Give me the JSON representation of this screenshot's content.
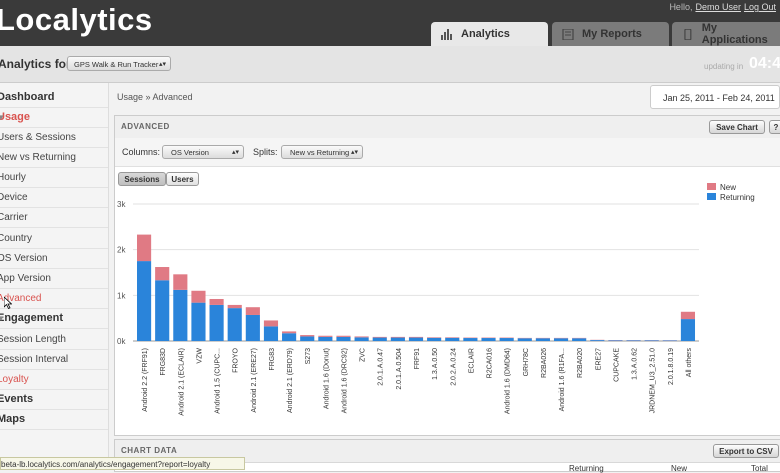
{
  "header": {
    "logo": "Localytics",
    "hello": "Hello,",
    "user": "Demo User",
    "logout": "Log Out",
    "tabs": [
      {
        "label": "Analytics",
        "active": true,
        "icon": "bar-chart-icon"
      },
      {
        "label": "My Reports",
        "active": false,
        "icon": "report-icon"
      },
      {
        "label": "My Applications",
        "active": false,
        "icon": "phone-icon"
      }
    ]
  },
  "subbar": {
    "label": "Analytics for:",
    "app": "GPS Walk & Run Tracker",
    "updating": "updating in",
    "clock": "04:4"
  },
  "sidebar": {
    "items": [
      {
        "label": "Dashboard",
        "type": "head"
      },
      {
        "label": "Usage",
        "type": "head-active"
      },
      {
        "label": "Users & Sessions",
        "type": "item"
      },
      {
        "label": "New vs Returning",
        "type": "item"
      },
      {
        "label": "Hourly",
        "type": "item"
      },
      {
        "label": "Device",
        "type": "item"
      },
      {
        "label": "Carrier",
        "type": "item"
      },
      {
        "label": "Country",
        "type": "item"
      },
      {
        "label": "OS Version",
        "type": "item"
      },
      {
        "label": "App Version",
        "type": "item"
      },
      {
        "label": "Advanced",
        "type": "active"
      },
      {
        "label": "Engagement",
        "type": "head"
      },
      {
        "label": "Session Length",
        "type": "item"
      },
      {
        "label": "Session Interval",
        "type": "item"
      },
      {
        "label": "Loyalty",
        "type": "active"
      },
      {
        "label": "Events",
        "type": "head"
      },
      {
        "label": "Maps",
        "type": "head"
      }
    ]
  },
  "main": {
    "breadcrumb": "Usage » Advanced",
    "date_range": "Jan 25, 2011 - Feb 24, 2011",
    "panel_title": "ADVANCED",
    "save_chart": "Save Chart",
    "help": "?",
    "columns_label": "Columns:",
    "columns_value": "OS Version",
    "splits_label": "Splits:",
    "splits_value": "New vs Returning",
    "toggle_sessions": "Sessions",
    "toggle_users": "Users",
    "chart_data_title": "CHART DATA",
    "export_csv": "Export to CSV",
    "col_fragments": [
      "Returning",
      "New",
      "Total"
    ]
  },
  "status_url": "beta-lb.localytics.com/analytics/engagement?report=loyalty",
  "colors": {
    "new": "#e07a84",
    "returning": "#2a84da"
  },
  "chart_data": {
    "type": "bar",
    "stacked": true,
    "title": "",
    "xlabel": "",
    "ylabel": "",
    "ylim": [
      0,
      3000
    ],
    "y_ticks": [
      "0k",
      "1k",
      "2k",
      "3k"
    ],
    "y_tick_values": [
      0,
      1000,
      2000,
      3000
    ],
    "grid": true,
    "legend": "top-right",
    "categories": [
      "Android 2.2 (FRF91)",
      "FRG83D",
      "Android 2.1 (ECLAIR)",
      "VZW",
      "Android 1.5 (CUPC...",
      "FROYO",
      "Android 2.1 (ERE27)",
      "FRG83",
      "Android 2.1 (ERD79)",
      "S273",
      "Android 1.6 (Donut)",
      "Android 1.6 (DRC92)",
      "ZVC",
      "2.0.1.A.0.47",
      "2.0.1.A.0.504",
      "FRF91",
      "1.3.A.0.50",
      "2.0.2.A.0.24",
      "ECLAIR",
      "R2CA016",
      "Android 1.6 (DMD64)",
      "GRH78C",
      "R2BA026",
      "Android 1.6 (R1FA...",
      "R2BA020",
      "ERE27",
      "CUPCAKE",
      "1.3.A.0.62",
      "JRDNEM_U3_2.51.0",
      "2.0.1.8.0.19",
      "All others"
    ],
    "series": [
      {
        "name": "New",
        "values": [
          580,
          290,
          340,
          260,
          130,
          70,
          170,
          130,
          40,
          30,
          25,
          25,
          20,
          15,
          15,
          15,
          12,
          12,
          10,
          10,
          10,
          8,
          8,
          8,
          8,
          6,
          6,
          5,
          5,
          5,
          160
        ]
      },
      {
        "name": "Returning",
        "values": [
          1750,
          1330,
          1120,
          840,
          790,
          720,
          570,
          320,
          170,
          100,
          90,
          90,
          80,
          75,
          75,
          75,
          70,
          70,
          65,
          65,
          65,
          60,
          60,
          60,
          60,
          20,
          15,
          15,
          15,
          12,
          480
        ]
      }
    ]
  }
}
